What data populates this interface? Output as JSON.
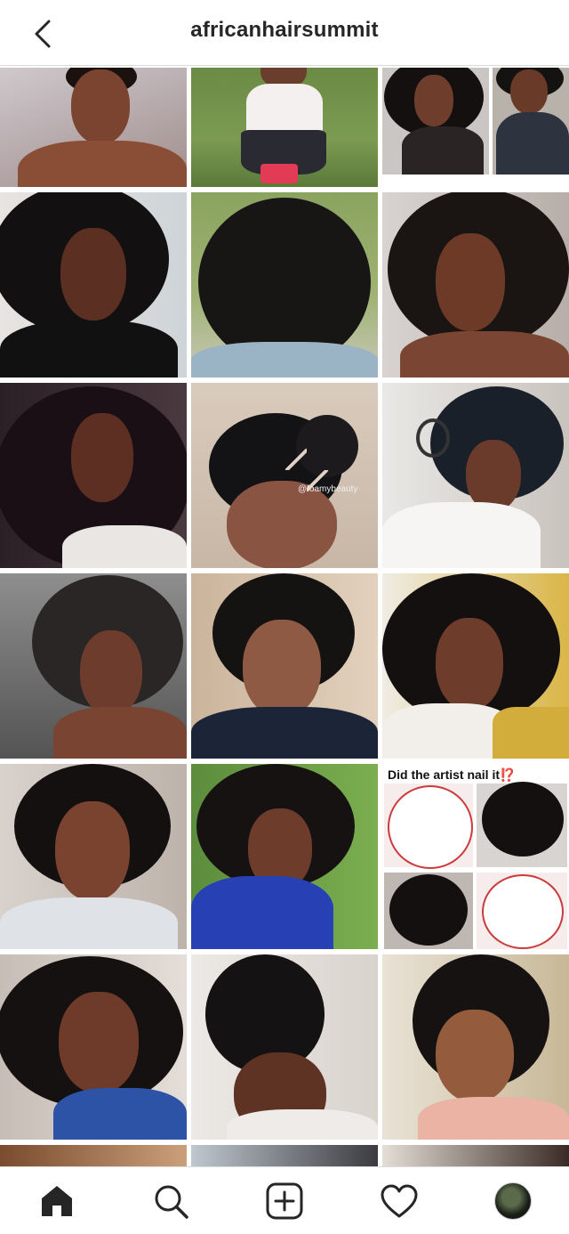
{
  "header": {
    "title": "africanhairsummit"
  },
  "posts": [
    {
      "label": "post-1"
    },
    {
      "label": "post-2"
    },
    {
      "label": "post-3"
    },
    {
      "label": "post-4"
    },
    {
      "label": "post-5"
    },
    {
      "label": "post-6"
    },
    {
      "label": "post-7"
    },
    {
      "label": "post-8",
      "watermark": "@foamybeauty"
    },
    {
      "label": "post-9"
    },
    {
      "label": "post-10"
    },
    {
      "label": "post-11"
    },
    {
      "label": "post-12"
    },
    {
      "label": "post-13"
    },
    {
      "label": "post-14"
    },
    {
      "label": "post-15",
      "caption": "Did the artist nail it⁉️"
    },
    {
      "label": "post-16"
    },
    {
      "label": "post-17"
    },
    {
      "label": "post-18"
    }
  ],
  "nav": {
    "items": [
      "home-icon",
      "search-icon",
      "new-post-icon",
      "activity-heart-icon",
      "profile-avatar"
    ]
  },
  "colors": {
    "border": "#dbdbdb",
    "text": "#262626",
    "icon": "#262626"
  }
}
